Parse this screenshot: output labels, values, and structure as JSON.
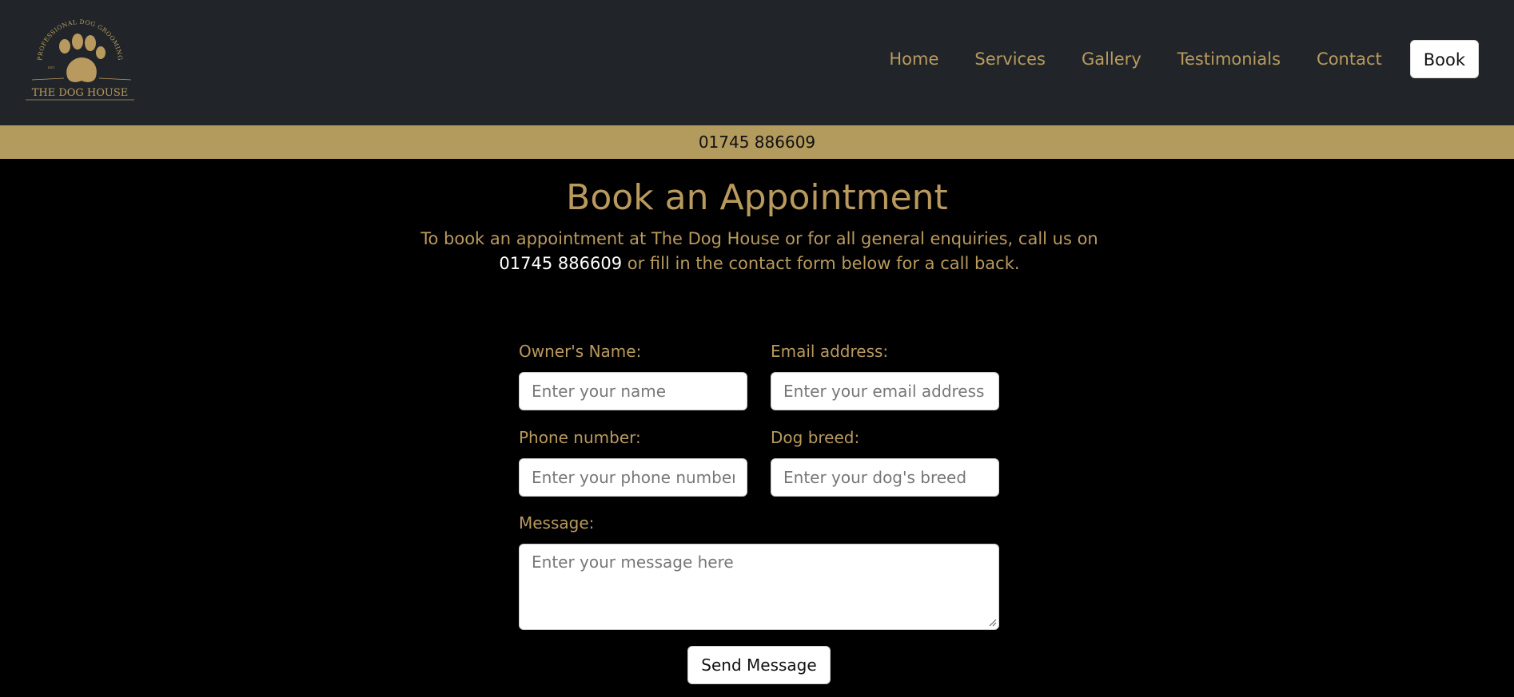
{
  "brand": {
    "name": "THE DOG HOUSE",
    "tagline": "PROFESSIONAL DOG GROOMING",
    "est": "EST"
  },
  "nav": {
    "items": [
      "Home",
      "Services",
      "Gallery",
      "Testimonials",
      "Contact"
    ],
    "book_label": "Book"
  },
  "phone_bar": "01745 886609",
  "page": {
    "title": "Book an Appointment",
    "intro_before": "To book an appointment at The Dog House or for all general enquiries, call us on ",
    "intro_phone": "01745 886609",
    "intro_after": " or fill in the contact form below for a call back."
  },
  "form": {
    "owner_label": "Owner's Name:",
    "owner_placeholder": "Enter your name",
    "email_label": "Email address:",
    "email_placeholder": "Enter your email address",
    "phone_label": "Phone number:",
    "phone_placeholder": "Enter your phone number",
    "breed_label": "Dog breed:",
    "breed_placeholder": "Enter your dog's breed",
    "message_label": "Message:",
    "message_placeholder": "Enter your message here",
    "submit_label": "Send Message"
  },
  "colors": {
    "gold": "#b99a5e",
    "header_bg": "#212529",
    "phone_bar_bg": "#b39a5d",
    "page_bg": "#000000"
  }
}
